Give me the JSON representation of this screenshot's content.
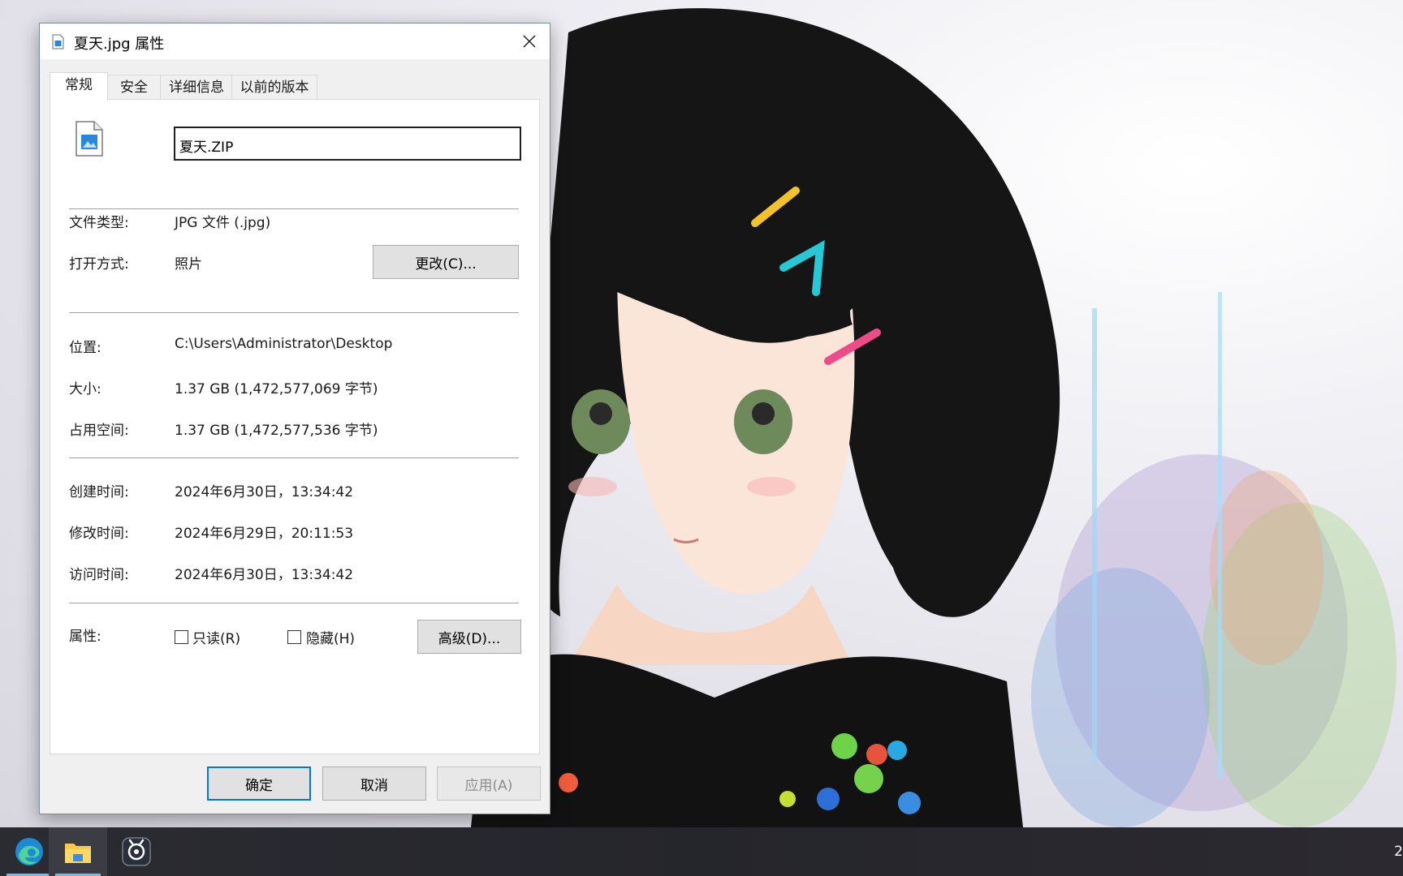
{
  "dialog": {
    "title": "夏天.jpg 属性",
    "tabs": [
      {
        "label": "常规",
        "active": true
      },
      {
        "label": "安全",
        "active": false
      },
      {
        "label": "详细信息",
        "active": false
      },
      {
        "label": "以前的版本",
        "active": false
      }
    ],
    "file_name_value": "夏天.ZIP",
    "fields": {
      "type_label": "文件类型:",
      "type_value": "JPG 文件 (.jpg)",
      "open_with_label": "打开方式:",
      "open_with_value": "照片",
      "change_button": "更改(C)...",
      "location_label": "位置:",
      "location_value": "C:\\Users\\Administrator\\Desktop",
      "size_label": "大小:",
      "size_value": "1.37 GB (1,472,577,069 字节)",
      "size_on_disk_label": "占用空间:",
      "size_on_disk_value": "1.37 GB (1,472,577,536 字节)",
      "created_label": "创建时间:",
      "created_value": "2024年6月30日，13:34:42",
      "modified_label": "修改时间:",
      "modified_value": "2024年6月29日，20:11:53",
      "accessed_label": "访问时间:",
      "accessed_value": "2024年6月30日，13:34:42",
      "attributes_label": "属性:",
      "readonly_label": "只读(R)",
      "readonly_checked": false,
      "hidden_label": "隐藏(H)",
      "hidden_checked": false,
      "advanced_button": "高级(D)..."
    },
    "buttons": {
      "ok": "确定",
      "cancel": "取消",
      "apply": "应用(A)"
    }
  },
  "taskbar": {
    "items": [
      "edge-icon",
      "file-explorer-icon",
      "capture-app-icon"
    ],
    "clock_partial": "2"
  },
  "colors": {
    "accent": "#0078d7",
    "taskbar_bg": "#2b2b32",
    "dialog_bg": "#f0f0f0"
  }
}
